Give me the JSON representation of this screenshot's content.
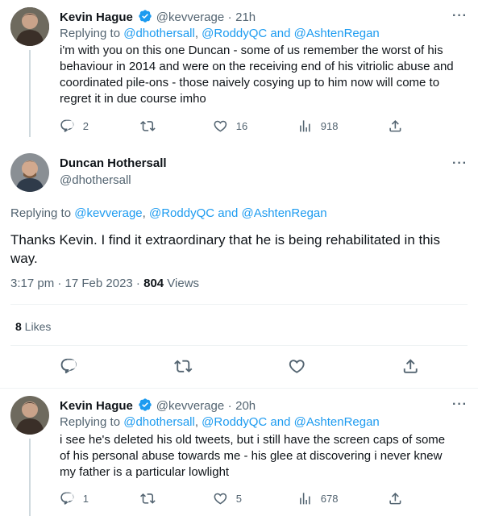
{
  "tweet1": {
    "name": "Kevin Hague",
    "handle": "@kevverage",
    "sep": "·",
    "time": "21h",
    "replying_prefix": "Replying to ",
    "replying_user1": "@dhothersall",
    "replying_sep": ", ",
    "replying_user2": "@RoddyQC",
    "replying_and": " and ",
    "replying_user3": "@AshtenRegan",
    "text_line1": "i'm with you on this one Duncan - some of us remember the worst of his",
    "text_line2": "behaviour in 2014 and were on the receiving end of his vitriolic abuse and",
    "text_line3": "coordinated pile-ons - those naively cosying up to him now will come to",
    "text_line4": "regret it in due course imho",
    "replies": "2",
    "likes": "16",
    "views": "918",
    "more": "···"
  },
  "tweet2": {
    "name": "Duncan Hothersall",
    "handle": "@dhothersall",
    "replying_prefix": "Replying to ",
    "replying_user1": "@kevverage",
    "replying_sep": ", ",
    "replying_user2": "@RoddyQC",
    "replying_and": " and ",
    "replying_user3": "@AshtenRegan",
    "text_line1": "Thanks Kevin. I find it extraordinary that he is being rehabilitated in this",
    "text_line2": "way.",
    "timestamp": "3:17 pm · 17 Feb 2023 · ",
    "views_count": "804",
    "views_label": " Views",
    "likes_count": "8",
    "likes_label": " Likes",
    "more": "···"
  },
  "tweet3": {
    "name": "Kevin Hague",
    "handle": "@kevverage",
    "sep": "·",
    "time": "20h",
    "replying_prefix": "Replying to ",
    "replying_user1": "@dhothersall",
    "replying_sep": ", ",
    "replying_user2": "@RoddyQC",
    "replying_and": " and ",
    "replying_user3": "@AshtenRegan",
    "text_line1": "i see he's deleted his old tweets, but i still have the screen caps of some",
    "text_line2": "of his personal abuse towards me - his glee at discovering i never knew",
    "text_line3": "my father is a particular lowlight",
    "replies": "1",
    "likes": "5",
    "views": "678",
    "more": "···"
  },
  "colors": {
    "accent": "#1d9bf0",
    "muted": "#536471",
    "text": "#0f1419",
    "divider": "#eff3f4"
  }
}
